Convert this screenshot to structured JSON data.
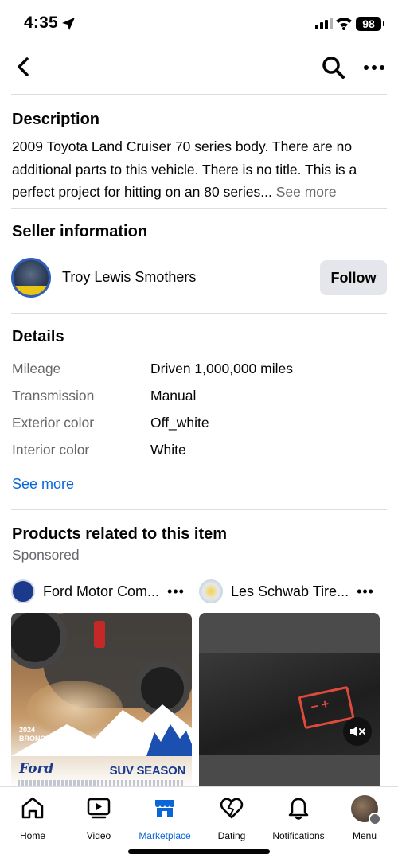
{
  "status_bar": {
    "time": "4:35",
    "battery": "98"
  },
  "description": {
    "title": "Description",
    "text": "2009 Toyota Land Cruiser 70 series body. There are no additional parts to this vehicle. There is no title. This is a perfect project for hitting on an 80 series...",
    "see_more": "See more"
  },
  "seller": {
    "title": "Seller information",
    "name": "Troy Lewis Smothers",
    "follow_label": "Follow"
  },
  "details": {
    "title": "Details",
    "rows": [
      {
        "label": "Mileage",
        "value": "Driven 1,000,000 miles"
      },
      {
        "label": "Transmission",
        "value": "Manual"
      },
      {
        "label": "Exterior color",
        "value": "Off_white"
      },
      {
        "label": "Interior color",
        "value": "White"
      }
    ],
    "see_more": "See more"
  },
  "products": {
    "title": "Products related to this item",
    "sponsored": "Sponsored",
    "ads": [
      {
        "advertiser": "Ford Motor Com...",
        "more": "•••",
        "bronco_year": "2024",
        "bronco_model": "BRONCO® SUV",
        "brand": "Ford",
        "headline": "SUV SEASON"
      },
      {
        "advertiser": "Les Schwab Tire...",
        "more": "•••"
      }
    ]
  },
  "tab_bar": {
    "active": "Marketplace",
    "tabs": [
      {
        "label": "Home"
      },
      {
        "label": "Video"
      },
      {
        "label": "Marketplace"
      },
      {
        "label": "Dating"
      },
      {
        "label": "Notifications"
      },
      {
        "label": "Menu"
      }
    ]
  },
  "colors": {
    "accent": "#0a66d8",
    "secondary_text": "#65676b",
    "button_bg": "#e4e6eb",
    "divider": "#dadde1"
  },
  "icons": [
    "location-arrow-icon",
    "signal-icon",
    "wifi-icon",
    "back-chevron-icon",
    "search-icon",
    "more-icon",
    "mute-icon",
    "home-icon",
    "video-icon",
    "marketplace-icon",
    "dating-icon",
    "notifications-icon"
  ]
}
